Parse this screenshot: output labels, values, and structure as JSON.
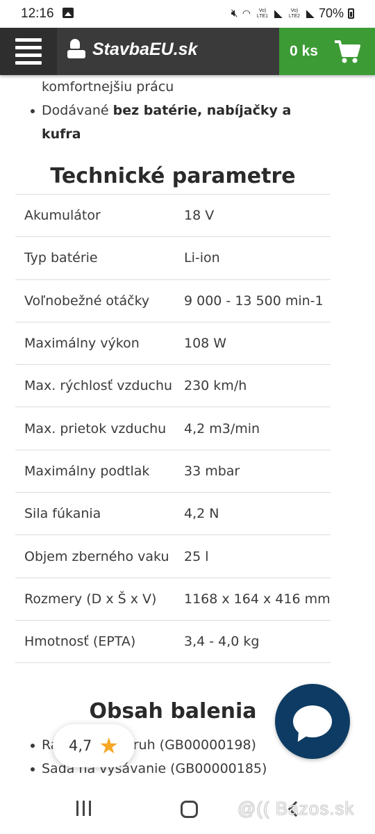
{
  "status_bar": {
    "time": "12:16",
    "battery": "70%",
    "sim1": "Vo) LTE1",
    "sim2": "Vo) LTE2"
  },
  "header": {
    "logo_text": "StavbaEU.sk",
    "cart_label": "0 ks"
  },
  "intro_bullets": [
    {
      "text": "komfortnejšiu prácu",
      "bold": "",
      "continuation": true
    },
    {
      "text": "Dodávané ",
      "bold": "bez batérie, nabíjačky a kufra",
      "continuation": false
    }
  ],
  "tech_heading": "Technické parametre",
  "parameters": [
    {
      "name": "Akumulátor",
      "value": "18 V"
    },
    {
      "name": "Typ batérie",
      "value": "Li-ion"
    },
    {
      "name": "Voľnobežné otáčky",
      "value": "9 000 - 13 500 min-1"
    },
    {
      "name": "Maximálny výkon",
      "value": "108 W"
    },
    {
      "name": "Max. rýchlosť vzduchu",
      "value": "230 km/h"
    },
    {
      "name": "Max. prietok vzduchu",
      "value": "4,2 m3/min"
    },
    {
      "name": "Maximálny podtlak",
      "value": "33 mbar"
    },
    {
      "name": "Sila fúkania",
      "value": "4,2 N"
    },
    {
      "name": "Objem zberného vaku",
      "value": "25 l"
    },
    {
      "name": "Rozmery (D x Š x V)",
      "value": "1168 x 164 x 416 mm"
    },
    {
      "name": "Hmotnosť (EPTA)",
      "value": "3,4 - 4,0 kg"
    }
  ],
  "package_heading": "Obsah balenia",
  "package_items": [
    "Ramenný popruh (GB00000198)",
    "Sada na vysávanie (GB00000185)",
    "Dodávané bez batérie, nabíjačky a kufra"
  ],
  "rating": {
    "value": "4,7",
    "icon": "star-icon",
    "color": "#f5a623"
  },
  "chat": {
    "icon": "chat-bubble-icon",
    "color": "#0d3b63"
  },
  "watermark": "@(( Bazos.sk",
  "colors": {
    "header_bg": "#3a3a3a",
    "cart_bg": "#3d9b35"
  }
}
